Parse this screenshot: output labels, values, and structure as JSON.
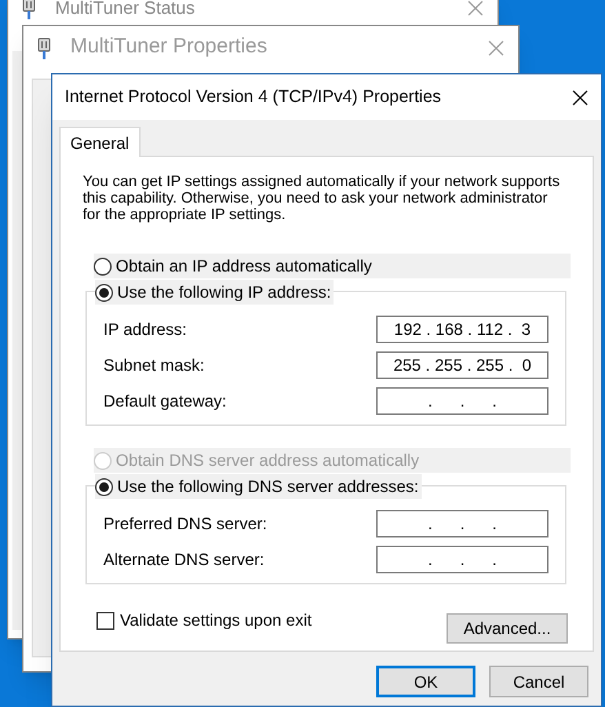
{
  "back_windows": [
    {
      "title": "MultiTuner Status"
    },
    {
      "title": "MultiTuner Properties"
    }
  ],
  "dialog": {
    "title": "Internet Protocol Version 4 (TCP/IPv4) Properties",
    "tabs": [
      {
        "label": "General",
        "selected": true
      }
    ],
    "intro": "You can get IP settings assigned automatically if your network supports this capability. Otherwise, you need to ask your network administrator for the appropriate IP settings.",
    "ip_options": [
      {
        "label": "Obtain an IP address automatically",
        "selected": false,
        "disabled": false
      },
      {
        "label": "Use the following IP address:",
        "selected": true,
        "disabled": false
      }
    ],
    "ip_fields": [
      {
        "label": "IP address:",
        "value": "192 . 168 . 112 .  3"
      },
      {
        "label": "Subnet mask:",
        "value": "255 . 255 . 255 .  0"
      },
      {
        "label": "Default gateway:",
        "value": ".      .      ."
      }
    ],
    "dns_options": [
      {
        "label": "Obtain DNS server address automatically",
        "selected": false,
        "disabled": true
      },
      {
        "label": "Use the following DNS server addresses:",
        "selected": true,
        "disabled": false
      }
    ],
    "dns_fields": [
      {
        "label": "Preferred DNS server:",
        "value": ".      .      ."
      },
      {
        "label": "Alternate DNS server:",
        "value": ".      .      ."
      }
    ],
    "validate": {
      "label": "Validate settings upon exit",
      "checked": false
    },
    "advanced_button": "Advanced...",
    "buttons": [
      {
        "label": "OK",
        "default": true
      },
      {
        "label": "Cancel",
        "default": false
      }
    ]
  }
}
